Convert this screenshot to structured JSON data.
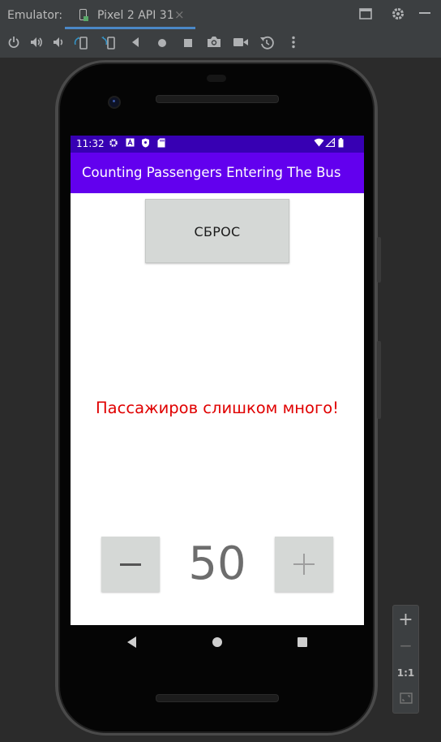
{
  "ide": {
    "emulator_label": "Emulator:",
    "device_tab": "Pixel 2 API 31",
    "close_glyph": "×",
    "icons": [
      "window-icon",
      "gear-icon",
      "minimize-icon"
    ]
  },
  "toolbar": {
    "icons": [
      "power-icon",
      "volume-up-icon",
      "volume-down-icon",
      "rotate-left-icon",
      "rotate-right-icon",
      "back-icon",
      "home-icon",
      "overview-icon",
      "screenshot-icon",
      "record-icon",
      "snapshot-icon",
      "more-icon"
    ]
  },
  "device": {
    "status_time": "11:32",
    "app_title": "Counting Passengers Entering The Bus",
    "reset_label": "СБРОС",
    "warning_text": "Пассажиров слишком много!",
    "count": "50",
    "colors": {
      "status_bar": "#3700b3",
      "app_bar": "#6200ee",
      "warning": "#e00000",
      "button": "#d5d8d6"
    }
  },
  "zoom": {
    "zoom_in": "+",
    "zoom_out": "−",
    "actual_size": "1:1"
  }
}
